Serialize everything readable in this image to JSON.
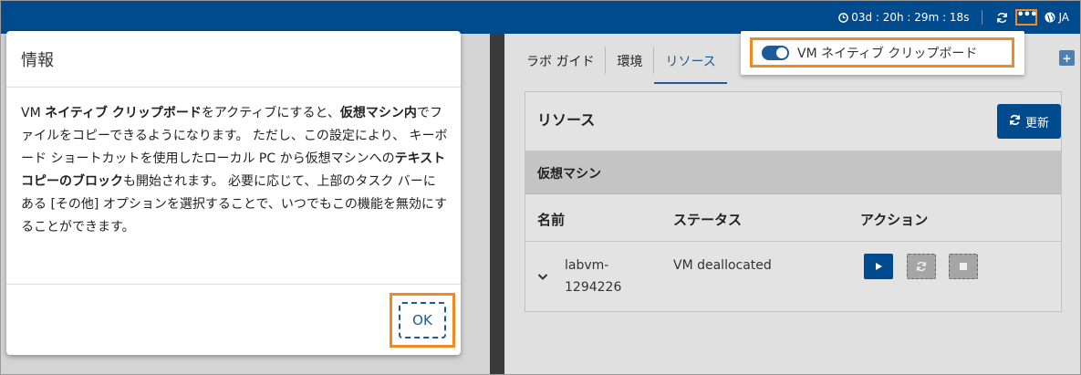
{
  "topbar": {
    "timer": "03d : 20h : 29m : 18s",
    "more_label": "•••",
    "lang": "JA"
  },
  "modal": {
    "title": "情報",
    "body": {
      "p1": "VM ",
      "p1b": "ネイティブ クリップボード",
      "p2": "をアクティブにすると、",
      "p2b": "仮想マシン内",
      "p3": "でファイルをコピーできるようになります。 ただし、この設定により、 キーボード ショートカットを使用したローカル PC から仮想マシンへの",
      "p3b": "テキスト コピーのブロック",
      "p4": "も開始されます。 必要に応じて、上部のタスク バーにある [その他] オプションを選択することで、いつでもこの機能を無効にすることができます。"
    },
    "ok_label": "OK"
  },
  "right_panel": {
    "tabs": [
      {
        "label": "ラボ ガイド"
      },
      {
        "label": "環境"
      },
      {
        "label": "リソース"
      }
    ],
    "dropdown": {
      "clipboard_label": "VM ネイティブ クリップボード",
      "enabled": true
    },
    "resources": {
      "title": "リソース",
      "refresh_label": "更新",
      "section": "仮想マシン",
      "columns": [
        "名前",
        "ステータス",
        "アクション"
      ],
      "rows": [
        {
          "name": "labvm-1294226",
          "status": "VM deallocated"
        }
      ]
    }
  },
  "colors": {
    "topbar": "#004b8d",
    "accent": "#1d5a9a",
    "highlight": "#f08a24"
  }
}
